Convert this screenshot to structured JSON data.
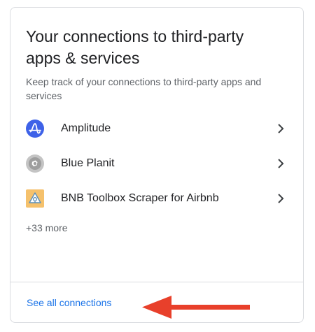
{
  "card": {
    "title": "Your connections to third-party apps & services",
    "description": "Keep track of your connections to third-party apps and services",
    "apps": [
      {
        "name": "Amplitude",
        "icon": "amplitude-logo-icon",
        "color": "#3e62e8"
      },
      {
        "name": "Blue Planit",
        "icon": "blue-planit-logo-icon",
        "color": "#bdbdbd"
      },
      {
        "name": "BNB Toolbox Scraper for Airbnb",
        "icon": "bnb-toolbox-logo-icon",
        "color": "#f5c16c"
      }
    ],
    "more_label": "+33 more",
    "see_all_label": "See all connections"
  },
  "colors": {
    "link": "#1a73e8",
    "annotation_arrow": "#e8402b",
    "secondary_text": "#5f6368",
    "border": "#dadce0"
  }
}
